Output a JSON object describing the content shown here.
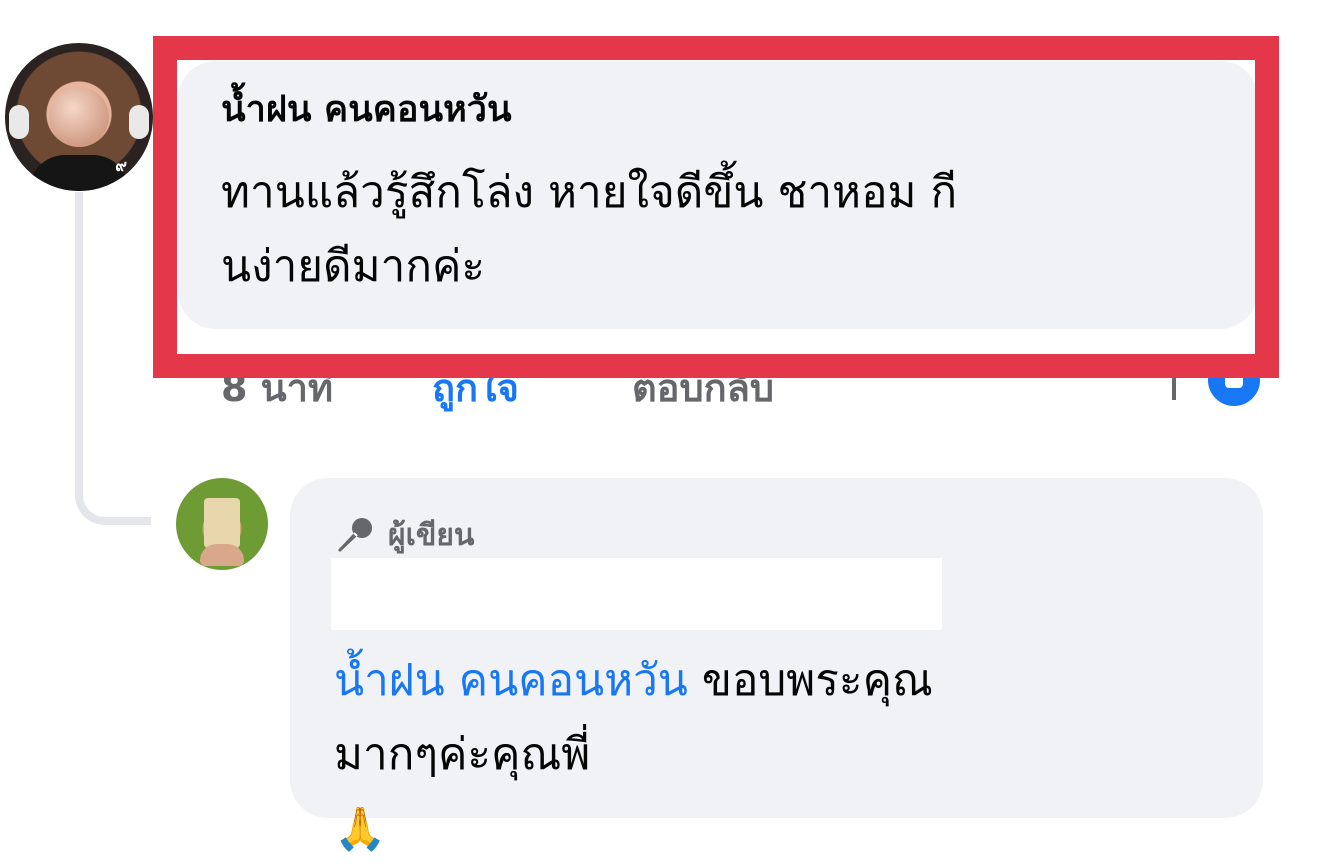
{
  "comment": {
    "author": "น้ำฝน คนคอนหวัน",
    "text_lines": [
      "ทานแล้วรู้สึกโล่ง หายใจดีขึ้น ชาหอม กี",
      "นง่ายดีมากค่ะ"
    ],
    "time": "8 นาที",
    "like_label": "ถูกใจ",
    "reply_label": "ตอบกลับ",
    "reaction_icon": "like-icon",
    "highlight_color": "#e4374a"
  },
  "reply": {
    "author_badge": "ผู้เขียน",
    "badge_icon": "microphone-icon",
    "mention": "น้ำฝน คนคอนหวัน",
    "text_line1": " ขอบพระคุณ",
    "text_line2": "มากๆค่ะคุณพี่ ",
    "emoji": "🙏"
  },
  "colors": {
    "bubble": "#f0f2f5",
    "link": "#1877f2",
    "secondary_text": "#65676b",
    "thread_line": "#e4e6eb"
  }
}
